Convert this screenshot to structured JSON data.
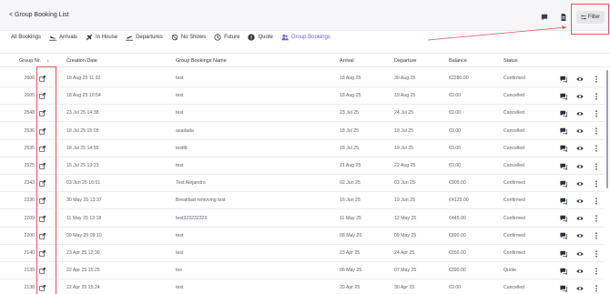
{
  "header": {
    "back_label": "< Group Booking List",
    "filter_label": "Filter"
  },
  "tabs": [
    {
      "label": "All Bookings",
      "icon": "none",
      "active": false
    },
    {
      "label": "Arrivals",
      "icon": "plane-landing-icon",
      "active": false
    },
    {
      "label": "In House",
      "icon": "plane-icon",
      "active": false
    },
    {
      "label": "Departures",
      "icon": "plane-takeoff-icon",
      "active": false
    },
    {
      "label": "No Shows",
      "icon": "no-show-icon",
      "active": false
    },
    {
      "label": "Future",
      "icon": "clock-icon",
      "active": false
    },
    {
      "label": "Quote",
      "icon": "quote-icon",
      "active": false
    },
    {
      "label": "Group Bookings",
      "icon": "group-icon",
      "active": true
    }
  ],
  "table": {
    "columns": [
      "Group Nr.",
      "Creation Date",
      "Group Bookings Name",
      "Arrival",
      "Departure",
      "Balance",
      "Status"
    ],
    "sort_indicator": "↓",
    "rows": [
      {
        "nr": "2606",
        "created": "18 Aug 25 11:32",
        "name": "test",
        "arrival": "18 Aug 25",
        "departure": "30 Aug 25",
        "balance": "€2280.00",
        "status": "Confirmed"
      },
      {
        "nr": "2605",
        "created": "18 Aug 25 10:54",
        "name": "test",
        "arrival": "18 Aug 25",
        "departure": "19 Aug 25",
        "balance": "€0.00",
        "status": "Cancelled"
      },
      {
        "nr": "2548",
        "created": "23 Jul 25 14:38",
        "name": "test",
        "arrival": "23 Jul 25",
        "departure": "24 Jul 25",
        "balance": "€0.00",
        "status": "Cancelled"
      },
      {
        "nr": "2536",
        "created": "18 Jul 25 15:05",
        "name": "asadada",
        "arrival": "18 Jul 25",
        "departure": "19 Jul 25",
        "balance": "€0.00",
        "status": "Cancelled"
      },
      {
        "nr": "2535",
        "created": "18 Jul 25 14:55",
        "name": "testttt",
        "arrival": "18 Jul 25",
        "departure": "19 Jul 25",
        "balance": "€0.00",
        "status": "Cancelled"
      },
      {
        "nr": "2525",
        "created": "15 Jul 25 13:23",
        "name": "test",
        "arrival": "21 Aug 25",
        "departure": "22 Aug 25",
        "balance": "€0.00",
        "status": "Cancelled"
      },
      {
        "nr": "2343",
        "created": "03 Jun 25 16:51",
        "name": "Test Alejandro",
        "arrival": "02 Jun 25",
        "departure": "03 Jun 25",
        "balance": "€905.00",
        "status": "Confirmed"
      },
      {
        "nr": "2336",
        "created": "30 May 25 13:37",
        "name": "Breakfast removing test",
        "arrival": "16 Jun 25",
        "departure": "19 Jun 25",
        "balance": "€4125.00",
        "status": "Confirmed"
      },
      {
        "nr": "2209",
        "created": "11 May 25 13:18",
        "name": "test323232323",
        "arrival": "11 May 25",
        "departure": "12 May 25",
        "balance": "€445.00",
        "status": "Confirmed"
      },
      {
        "nr": "2200",
        "created": "09 May 25 09:10",
        "name": "test",
        "arrival": "08 May 25",
        "departure": "09 May 25",
        "balance": "€890.00",
        "status": "Confirmed"
      },
      {
        "nr": "2140",
        "created": "23 Apr 25 12:30",
        "name": "test",
        "arrival": "23 Apr 25",
        "departure": "24 Apr 25",
        "balance": "€650.00",
        "status": "Confirmed"
      },
      {
        "nr": "2139",
        "created": "22 Apr 25 15:25",
        "name": "tes",
        "arrival": "06 May 25",
        "departure": "07 May 25",
        "balance": "€390.00",
        "status": "Quote"
      },
      {
        "nr": "2138",
        "created": "22 Apr 25 15:24",
        "name": "test",
        "arrival": "29 Apr 25",
        "departure": "30 Apr 25",
        "balance": "€0.00",
        "status": "Cancelled"
      }
    ]
  },
  "colors": {
    "accent": "#6f5fd6",
    "highlight": "#e35353",
    "header_bg": "#f6f6f8"
  }
}
